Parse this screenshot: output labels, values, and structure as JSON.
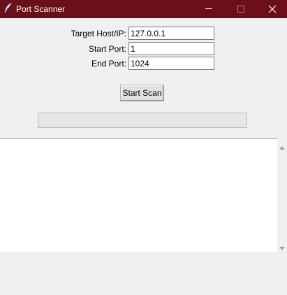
{
  "window": {
    "title": "Port Scanner",
    "icon": "feather-icon",
    "controls": [
      "minimize",
      "maximize",
      "close"
    ]
  },
  "form": {
    "host": {
      "label": "Target Host/IP:",
      "value": "127.0.0.1"
    },
    "start_port": {
      "label": "Start Port:",
      "value": "1"
    },
    "end_port": {
      "label": "End Port:",
      "value": "1024"
    }
  },
  "scan_button": {
    "label": "Start Scan"
  },
  "progress": {
    "value": 0
  },
  "output": {
    "text": ""
  },
  "colors": {
    "titlebar": "#6b0f18",
    "window_bg": "#f0f0f0",
    "output_bg": "#ffffff"
  }
}
